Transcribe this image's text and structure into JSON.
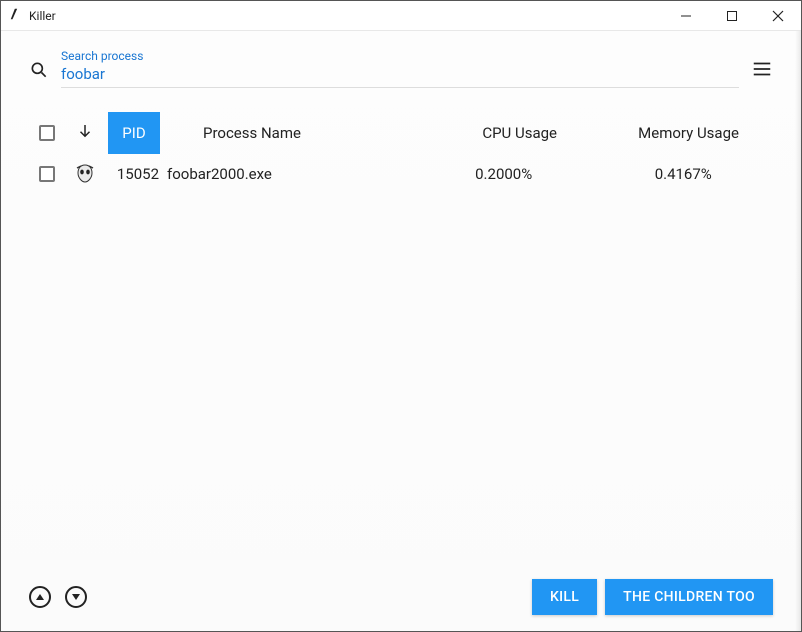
{
  "window": {
    "title": "Killer"
  },
  "search": {
    "label": "Search process",
    "value": "foobar"
  },
  "columns": {
    "pid": "PID",
    "name": "Process Name",
    "cpu": "CPU Usage",
    "mem": "Memory Usage"
  },
  "rows": [
    {
      "pid": "15052",
      "name": "foobar2000.exe",
      "cpu": "0.2000%",
      "mem": "0.4167%"
    }
  ],
  "actions": {
    "kill": "KILL",
    "kill_children": "THE CHILDREN TOO"
  }
}
